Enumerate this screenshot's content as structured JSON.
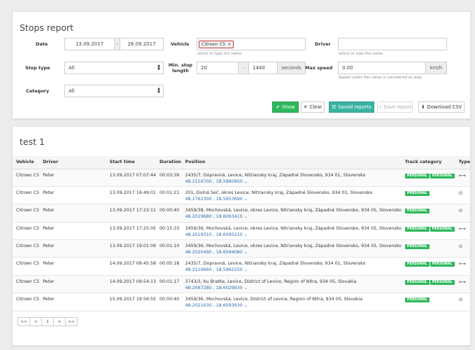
{
  "filters": {
    "title": "Stops report",
    "date_label": "Date",
    "date_from": "13.09.2017",
    "date_sep": "-",
    "date_to": "26.09.2017",
    "vehicle_label": "Vehicle",
    "vehicle_chip": "Citroen C5",
    "vehicle_chip_remove": "×",
    "vehicle_hint": "select or type the name",
    "driver_label": "Driver",
    "driver_value": "",
    "driver_hint": "select or type the name",
    "stop_type_label": "Stop type",
    "stop_type_value": "All",
    "min_stop_label_1": "Min. stop",
    "min_stop_label_2": "length",
    "min_stop_from": "20",
    "min_stop_sep": "-",
    "min_stop_to": "1440",
    "min_stop_unit": "seconds",
    "max_speed_label": "Max speed",
    "max_speed_value": "0.00",
    "max_speed_unit": "km/h",
    "max_speed_hint": "Speed under this value is considered as stop",
    "category_label": "Category",
    "category_value": "All"
  },
  "buttons": {
    "show": "Show",
    "clear": "Clear",
    "saved_reports": "Saved reports",
    "save_report": "Save report",
    "download_csv": "Download CSV"
  },
  "report": {
    "title": "test 1",
    "columns": [
      "Vehicle",
      "Driver",
      "Start time",
      "Duration",
      "Position",
      "Track category",
      "Type"
    ],
    "rows": [
      {
        "vehicle": "Citroen C5",
        "driver": "Peter",
        "start": "13.09.2017 07:07:44",
        "duration": "00:03:39",
        "position": "2435/7, Dopravná, Levice, Nitriansky kraj, Západné Slovensko, 934 01, Slovensko",
        "coords": "48.2116700 , 18.5960950",
        "categories": [
          "PERSONAL",
          "PERSONAL"
        ],
        "type": "⟷"
      },
      {
        "vehicle": "Citroen C5",
        "driver": "Peter",
        "start": "13.09.2017 16:49:01",
        "duration": "00:01:21",
        "position": "201, Dolná Seč, okres Levice, Nitriansky kraj, Západné Slovensko, 934 01, Slovensko",
        "coords": "48.1762300 , 18.5653690",
        "categories": [
          "PERSONAL"
        ],
        "type": "⊙"
      },
      {
        "vehicle": "Citroen C5",
        "driver": "Peter",
        "start": "13.09.2017 17:23:11",
        "duration": "00:00:40",
        "position": "3459/38, Mochovská, Levice, okres Levice, Nitriansky kraj, Západné Slovensko, 934 05, Slovensko",
        "coords": "48.2019680 , 18.6093410",
        "categories": [
          "PERSONAL"
        ],
        "type": "⊙"
      },
      {
        "vehicle": "Citroen C5",
        "driver": "Peter",
        "start": "13.09.2017 17:25:05",
        "duration": "00:15:33",
        "position": "3459/36, Mochovská, Levice, okres Levice, Nitriansky kraj, Západné Slovensko, 934 05, Slovensko",
        "coords": "48.2019310 , 18.6095210",
        "categories": [
          "PERSONAL",
          "PERSONAL"
        ],
        "type": "⟷"
      },
      {
        "vehicle": "Citroen C5",
        "driver": "Peter",
        "start": "13.09.2017 19:01:09",
        "duration": "00:01:10",
        "position": "3459/36, Mochovská, Levice, okres Levice, Nitriansky kraj, Západné Slovensko, 934 05, Slovensko",
        "coords": "48.2020490 , 18.6094080",
        "categories": [
          "PERSONAL"
        ],
        "type": "⊙"
      },
      {
        "vehicle": "Citroen C5",
        "driver": "Peter",
        "start": "14.09.2017 09:45:58",
        "duration": "00:05:18",
        "position": "2435/7, Dopravná, Levice, Nitriansky kraj, Západné Slovensko, 934 01, Slovensko",
        "coords": "48.2116660 , 18.5962250",
        "categories": [
          "PERSONAL",
          "PERSONAL"
        ],
        "type": "⟷"
      },
      {
        "vehicle": "Citroen C5",
        "driver": "Peter",
        "start": "14.09.2017 09:54:13",
        "duration": "00:01:17",
        "position": "3743/3, Ku Bratke, Levice, District of Levice, Region of Nitra, 934 05, Slovakia",
        "coords": "48.2067280 , 18.6029930",
        "categories": [
          "PERSONAL",
          "PERSONAL"
        ],
        "type": "⟷"
      },
      {
        "vehicle": "Citroen C5",
        "driver": "Peter",
        "start": "15.09.2017 19:56:55",
        "duration": "00:00:40",
        "position": "3459/36, Mochovská, Levice, District of Levice, Region of Nitra, 934 05, Slovakia",
        "coords": "48.2021630 , 18.6093930",
        "categories": [
          "PERSONAL"
        ],
        "type": "⊙"
      }
    ]
  },
  "pager": {
    "first": "<<",
    "prev": "<",
    "current": "1",
    "next": ">",
    "last": ">>"
  },
  "colors": {
    "green": "#2eb85c",
    "teal": "#3bb3a2",
    "link": "#2a6ab0"
  }
}
